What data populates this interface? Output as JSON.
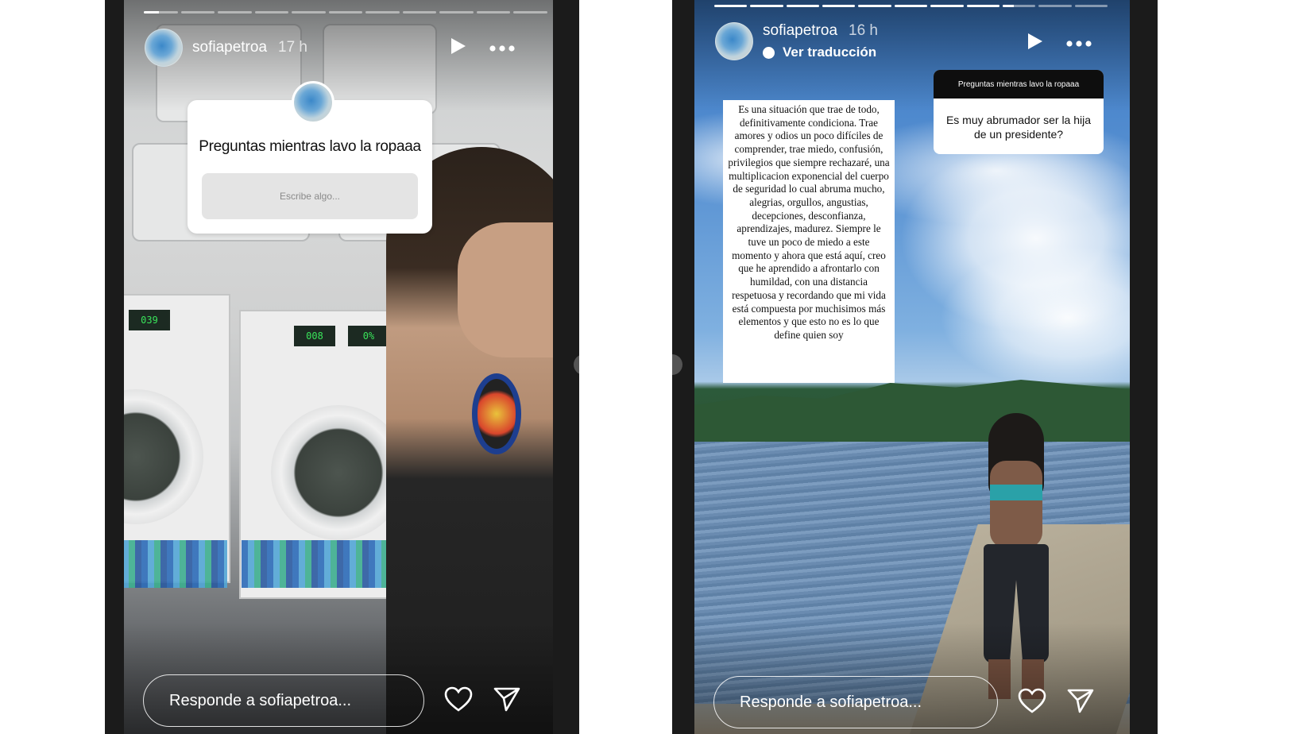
{
  "left_story": {
    "username": "sofiapetroa",
    "time": "17 h",
    "progress": {
      "segments": 11,
      "active_index": 0,
      "active_fill": 0.45
    },
    "question_sticker": {
      "title": "Preguntas mientras lavo la ropaaa",
      "placeholder": "Escribe algo..."
    },
    "lcd_readouts": [
      "039",
      "008",
      "0%"
    ],
    "reply_placeholder": "Responde a sofiapetroa...",
    "icons": {
      "play": "play-icon",
      "more": "more-icon",
      "like": "heart-icon",
      "share": "send-icon"
    }
  },
  "right_story": {
    "username": "sofiapetroa",
    "time": "16 h",
    "translate_label": "Ver traducción",
    "progress": {
      "segments": 11,
      "active_index": 8,
      "active_fill": 0.35
    },
    "answer_text": "Es una situación que trae de todo, definitivamente condiciona. Trae amores y odios un poco difíciles de comprender, trae miedo, confusión, privilegios que siempre rechazaré, una multiplicacion exponencial del cuerpo de seguridad lo cual abruma mucho, alegrias, orgullos, angustias, decepciones, desconfianza, aprendizajes, madurez. Siempre le tuve un poco de miedo a este momento y ahora que está aquí, creo que he aprendido a afrontarlo con humildad,  con una distancia respetuosa  y recordando que mi vida está compuesta por muchisimos más elementos y que esto no es lo que define quien soy",
    "question_card": {
      "header": "Preguntas mientras lavo la ropaaa",
      "question": "Es muy abrumador ser la hija de un presidente?"
    },
    "reply_placeholder": "Responde a sofiapetroa...",
    "icons": {
      "play": "play-icon",
      "more": "more-icon",
      "like": "heart-icon",
      "share": "send-icon"
    }
  }
}
